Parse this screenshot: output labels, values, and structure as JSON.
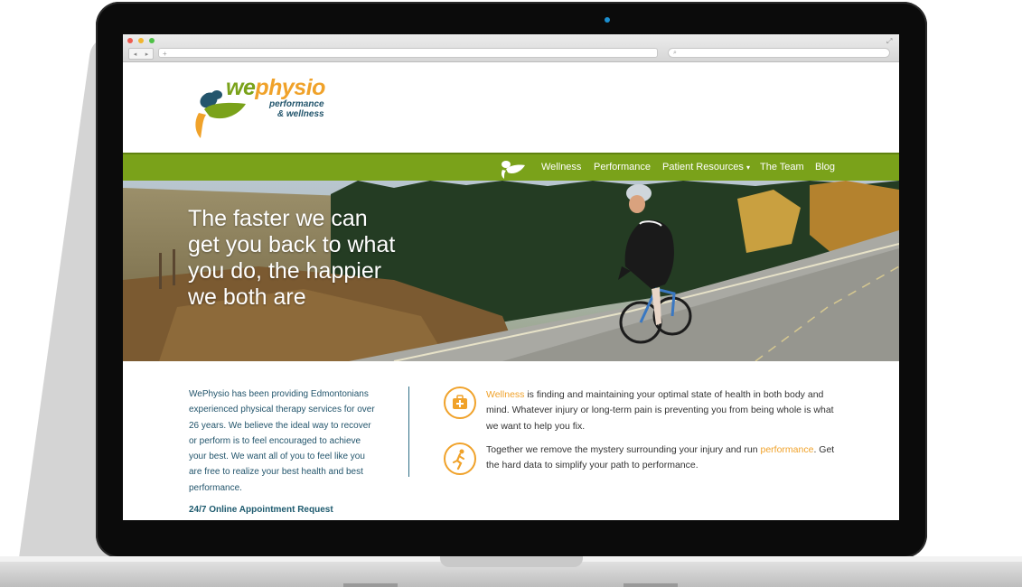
{
  "browser": {
    "address_placeholder": "+",
    "search_placeholder": "⌕",
    "back_glyph": "◂",
    "forward_glyph": "▸",
    "resize_glyph": "⤢"
  },
  "logo": {
    "we": "we",
    "physio": "physio",
    "tagline_1": "performance",
    "tagline_2": "& wellness",
    "colors": {
      "we": "#7aa21a",
      "physio": "#f0a22a",
      "tagline": "#23556c"
    }
  },
  "nav": {
    "items": [
      {
        "label": "Wellness"
      },
      {
        "label": "Performance"
      },
      {
        "label": "Patient Resources"
      },
      {
        "label": "The Team"
      },
      {
        "label": "Blog"
      }
    ],
    "dropdown_caret": "▾",
    "bar_color": "#7aa21a"
  },
  "hero": {
    "headline": "The faster we can get you back to what you do, the happier we both are"
  },
  "intro": {
    "text": "WePhysio has been providing Edmontonians experienced physical therapy services for over 26 years. We believe the ideal way to recover or perform is to feel encouraged to achieve your best. We want all of you to feel like you are free to realize your best health and best performance.",
    "appointment_link": "24/7 Online Appointment Request"
  },
  "features": [
    {
      "icon": "first-aid-kit-icon",
      "highlight": "Wellness",
      "text_before": "",
      "text_after": " is finding and maintaining your optimal state of health in both body and mind. Whatever injury or long-term pain is preventing you from being whole is what we want to help you fix."
    },
    {
      "icon": "runner-icon",
      "highlight": "performance",
      "text_before": "Together we remove the mystery surrounding your injury and run ",
      "text_after": ". Get the hard data to simplify your path to performance."
    }
  ],
  "colors": {
    "accent": "#f0a22a",
    "brand_green": "#7aa21a",
    "brand_teal": "#23556c"
  }
}
